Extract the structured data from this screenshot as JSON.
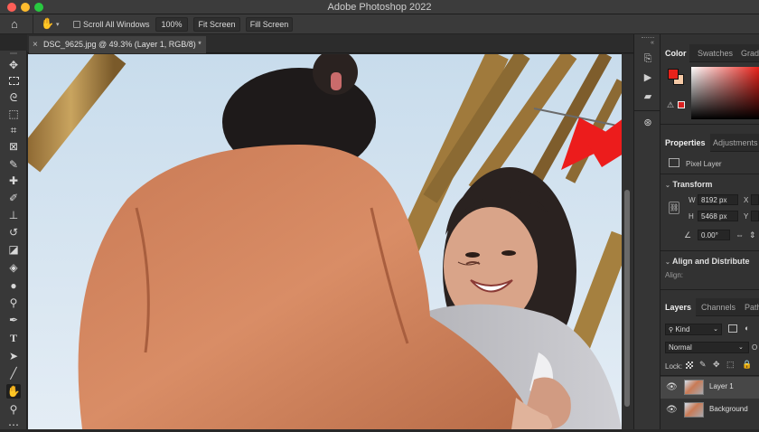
{
  "window": {
    "title": "Adobe Photoshop 2022"
  },
  "options_bar": {
    "scroll_all_windows": "Scroll All Windows",
    "zoom_button": "100%",
    "fit_screen": "Fit Screen",
    "fill_screen": "Fill Screen"
  },
  "document_tab": {
    "label": "DSC_9625.jpg @ 49.3% (Layer 1, RGB/8) *"
  },
  "color_panel": {
    "tabs": [
      "Color",
      "Swatches",
      "Gradi"
    ],
    "foreground": "#e8221a",
    "background": "#f5c9a6"
  },
  "properties_panel": {
    "tabs": [
      "Properties",
      "Adjustments"
    ],
    "layer_type": "Pixel Layer",
    "transform_header": "Transform",
    "w_label": "W",
    "w_value": "8192 px",
    "h_label": "H",
    "h_value": "5468 px",
    "x_label": "X",
    "y_label": "Y",
    "angle_value": "0.00°",
    "align_header": "Align and Distribute",
    "align_label": "Align:"
  },
  "layers_panel": {
    "tabs": [
      "Layers",
      "Channels",
      "Path"
    ],
    "kind": "Kind",
    "blend_mode": "Normal",
    "opacity_short": "O",
    "lock_label": "Lock:",
    "layers": [
      {
        "name": "Layer 1"
      },
      {
        "name": "Background"
      }
    ]
  }
}
